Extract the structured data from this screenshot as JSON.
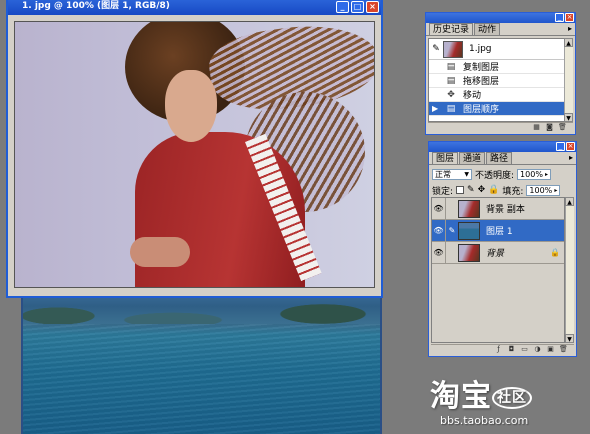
{
  "document_window": {
    "title": "1. jpg @ 100% (图层 1, RGB/8)",
    "buttons": {
      "minimize": "_",
      "maximize": "□",
      "close": "×"
    }
  },
  "history_panel": {
    "tabs": [
      "历史记录",
      "动作"
    ],
    "snapshot_name": "1.jpg",
    "steps": [
      {
        "label": "复制图层",
        "icon": "layer-icon"
      },
      {
        "label": "拖移图层",
        "icon": "layer-icon"
      },
      {
        "label": "移动",
        "icon": "move-icon"
      },
      {
        "label": "图层顺序",
        "icon": "layer-icon",
        "selected": true
      }
    ]
  },
  "layers_panel": {
    "tabs": [
      "图层",
      "通道",
      "路径"
    ],
    "blend_mode": "正常",
    "opacity_label": "不透明度:",
    "opacity_value": "100%",
    "lock_label": "锁定:",
    "fill_label": "填充:",
    "fill_value": "100%",
    "layers": [
      {
        "name": "背景 副本",
        "thumb": "girl",
        "selected": false
      },
      {
        "name": "图层 1",
        "thumb": "lake",
        "selected": true
      },
      {
        "name": "背景",
        "thumb": "girl",
        "selected": false,
        "locked": true
      }
    ]
  },
  "watermark": {
    "logo": "淘宝",
    "badge": "社区",
    "url": "bbs.taobao.com"
  },
  "colors": {
    "title_bar": "#1f55cc",
    "selection": "#316ac5",
    "panel_bg": "#d4d0c8",
    "workspace": "#7b7b7b"
  }
}
